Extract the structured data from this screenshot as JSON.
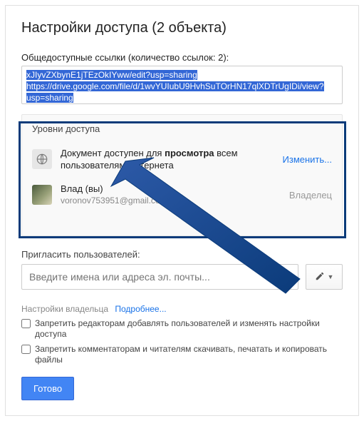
{
  "title": "Настройки доступа (2 объекта)",
  "links": {
    "label": "Общедоступные ссылки (количество ссылок: 2):",
    "line1": "xJIyvZXbynE1jTEzOkIYww/edit?usp=sharing",
    "line2": "https://drive.google.com/file/d/1wvYUIubU9HvhSuTOrHN17qlXDTrUgIDi/view?",
    "line3": "usp=sharing"
  },
  "access": {
    "header": "Уровни доступа",
    "public": {
      "text_prefix": "Документ доступен для ",
      "text_bold": "просмотра",
      "text_suffix": " всем пользователям Интернета",
      "change": "Изменить..."
    },
    "owner": {
      "name": "Влад (вы)",
      "email": "voronov753951@gmail.com",
      "role": "Владелец"
    }
  },
  "invite": {
    "label": "Пригласить пользователей:",
    "placeholder": "Введите имена или адреса эл. почты..."
  },
  "ownerSettings": {
    "label": "Настройки владельца",
    "more": "Подробнее...",
    "check1": "Запретить редакторам добавлять пользователей и изменять настройки доступа",
    "check2": "Запретить комментаторам и читателям скачивать, печатать и копировать файлы"
  },
  "done": "Готово"
}
